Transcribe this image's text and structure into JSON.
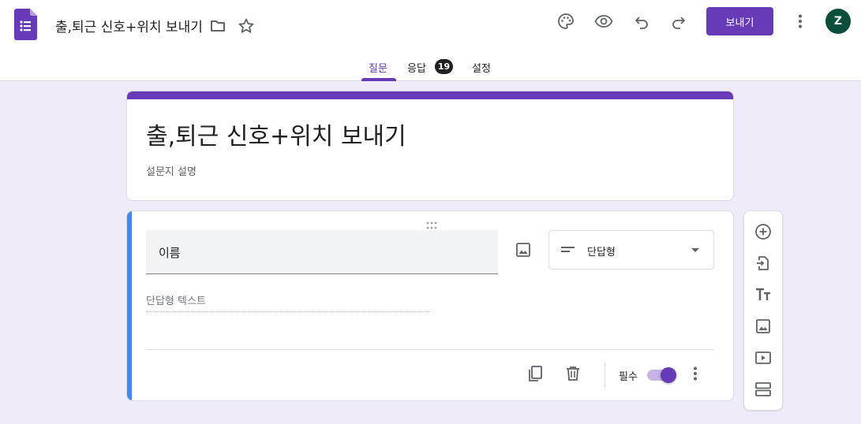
{
  "app": {
    "title": "출,퇴근 신호+위치 보내기",
    "send_label": "보내기",
    "avatar_letter": "Z",
    "accent_color": "#673ab7"
  },
  "tabs": [
    {
      "label": "질문",
      "active": true
    },
    {
      "label": "응답",
      "badge": "19"
    },
    {
      "label": "설정"
    }
  ],
  "form": {
    "title": "출,퇴근 신호+위치 보내기",
    "description_placeholder": "설문지 설명"
  },
  "question": {
    "title": "이름",
    "type": "단답형",
    "answer_placeholder": "단답형 텍스트",
    "required_label": "필수",
    "required": true
  },
  "icons": {
    "header": [
      "folder-icon",
      "star-icon",
      "palette-icon",
      "preview-icon",
      "undo-icon",
      "redo-icon",
      "more-vert-icon"
    ],
    "side_toolbar": [
      "add-question-icon",
      "import-questions-icon",
      "add-title-icon",
      "add-image-icon",
      "add-video-icon",
      "add-section-icon"
    ]
  }
}
